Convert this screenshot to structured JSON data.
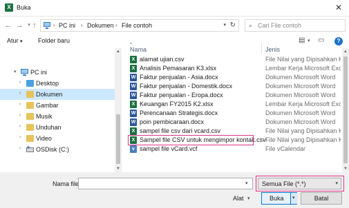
{
  "window": {
    "title": "Buka",
    "app_icon_letter": "X"
  },
  "address": {
    "crumbs": [
      "PC ini",
      "Dokumen",
      "File contoh"
    ]
  },
  "search": {
    "placeholder": "Cari File contoh"
  },
  "toolbar": {
    "organize": "Atur",
    "new_folder": "Folder baru"
  },
  "nav": {
    "items": [
      {
        "label": "PC ini",
        "icon": "pc-icon"
      },
      {
        "label": "Desktop",
        "icon": "folder-icon"
      },
      {
        "label": "Dokumen",
        "icon": "documents-icon",
        "selected": true
      },
      {
        "label": "Gambar",
        "icon": "pictures-icon"
      },
      {
        "label": "Musik",
        "icon": "music-icon"
      },
      {
        "label": "Unduhan",
        "icon": "downloads-icon"
      },
      {
        "label": "Video",
        "icon": "video-icon"
      },
      {
        "label": "OSDisk (C:)",
        "icon": "drive-icon"
      }
    ]
  },
  "files": {
    "columns": [
      "Nama",
      "Jenis"
    ],
    "rows": [
      {
        "name": "alamat ujian.csv",
        "type": "File Nilai yang Dipisahkan Koma",
        "icon": "excel-csv-icon"
      },
      {
        "name": "Analisis Pemasaran K3.xlsx",
        "type": "Lembar Kerja Microsoft Excel",
        "icon": "excel-icon"
      },
      {
        "name": "Faktur penjualan - Asia.docx",
        "type": "Dokumen Microsoft Word",
        "icon": "word-icon"
      },
      {
        "name": "Faktur penjualan - Domestik.docx",
        "type": "Dokumen Microsoft Word",
        "icon": "word-icon"
      },
      {
        "name": "Faktur penjualan - Eropa.docx",
        "type": "Dokumen Microsoft Word",
        "icon": "word-icon"
      },
      {
        "name": "Keuangan FY2015 K2.xlsx",
        "type": "Lembar Kerja Microsoft Excel",
        "icon": "excel-icon"
      },
      {
        "name": "Perencanaan Strategis.docx",
        "type": "Dokumen Microsoft Word",
        "icon": "word-icon"
      },
      {
        "name": "poin pembicaraan.docx",
        "type": "Dokumen Microsoft Word",
        "icon": "word-icon"
      },
      {
        "name": "sampel file csv dari vcard.csv",
        "type": "File Nilai yang Dipisahkan Koma",
        "icon": "excel-csv-icon"
      },
      {
        "name": "Sampel file CSV untuk mengimpor kontak.csv",
        "type": "File Nilai yang Dipisahkan Koma",
        "icon": "excel-csv-icon",
        "highlighted": true
      },
      {
        "name": "sampel file vCard.vcf",
        "type": "File vCalendar",
        "icon": "vcard-icon"
      }
    ]
  },
  "bottom": {
    "filename_label": "Nama file:",
    "filename_value": "",
    "filter_value": "Semua File (*.*)",
    "tools_label": "Alat",
    "open_label": "Buka",
    "cancel_label": "Batal"
  },
  "colors": {
    "highlight": "#e0318a",
    "selected": "#cce8ff",
    "accent": "#0078d7",
    "excel": "#1d6f42",
    "word": "#2b579a"
  }
}
